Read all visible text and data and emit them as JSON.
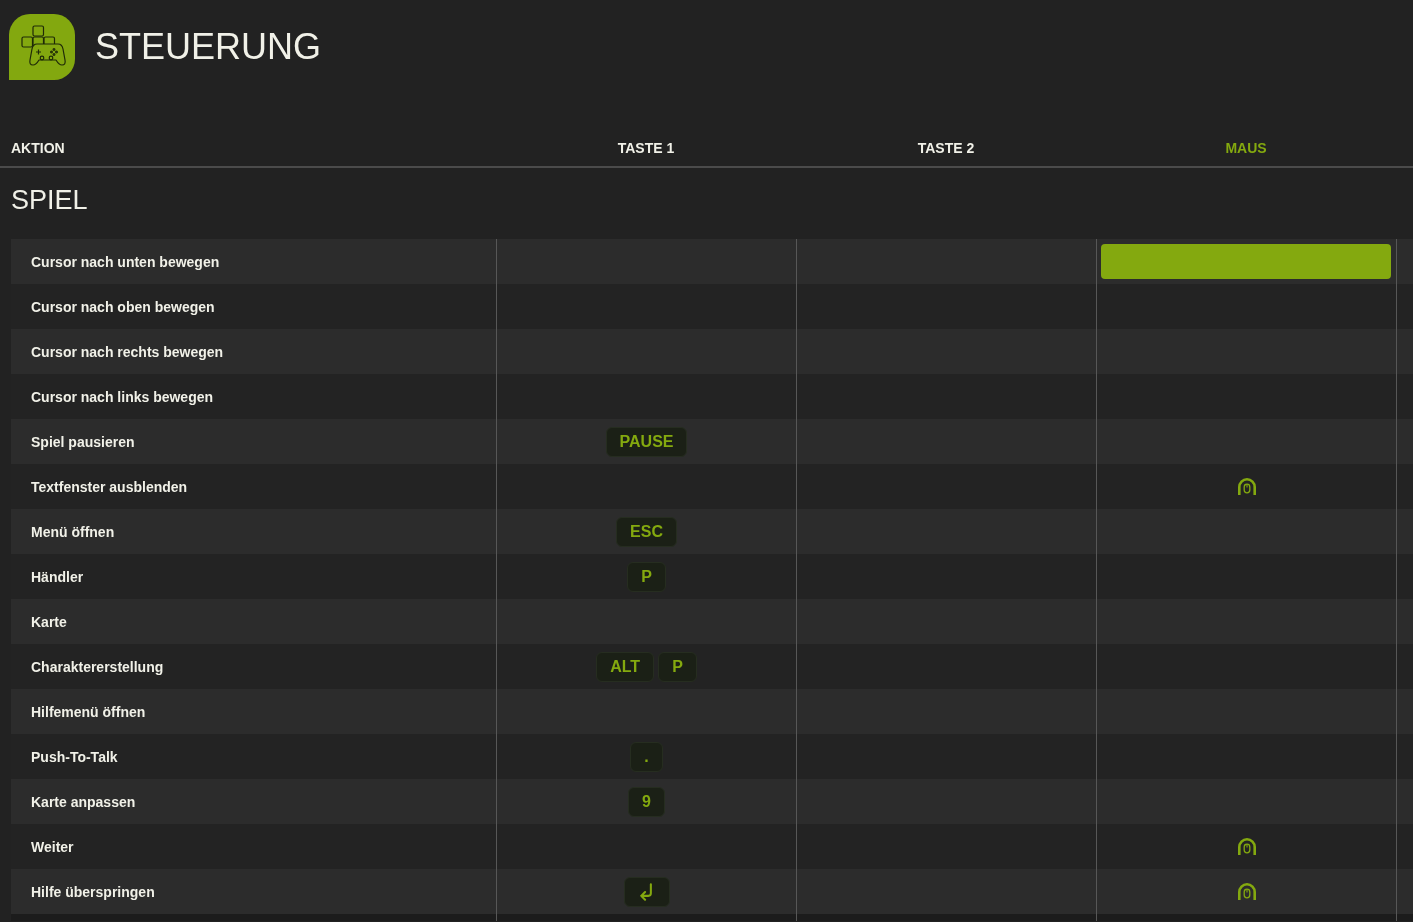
{
  "header": {
    "title": "STEUERUNG"
  },
  "columns": [
    {
      "label": "AKTION",
      "selected": false
    },
    {
      "label": "TASTE 1",
      "selected": false
    },
    {
      "label": "TASTE 2",
      "selected": false
    },
    {
      "label": "MAUS",
      "selected": true
    }
  ],
  "section": {
    "title": "SPIEL",
    "rows": [
      {
        "action": "Cursor nach unten bewegen",
        "bindings": [
          {
            "selected": false
          },
          {
            "selected": false
          },
          {
            "selected": true
          }
        ]
      },
      {
        "action": "Cursor nach oben bewegen",
        "bindings": [
          {
            "selected": false
          },
          {
            "selected": false
          },
          {
            "selected": false
          }
        ]
      },
      {
        "action": "Cursor nach rechts bewegen",
        "bindings": [
          {
            "selected": false
          },
          {
            "selected": false
          },
          {
            "selected": false
          }
        ]
      },
      {
        "action": "Cursor nach links bewegen",
        "bindings": [
          {
            "selected": false
          },
          {
            "selected": false
          },
          {
            "selected": false
          }
        ]
      },
      {
        "action": "Spiel pausieren",
        "bindings": [
          {
            "selected": false,
            "keys": [
              {
                "kind": "key",
                "label": "PAUSE"
              }
            ]
          },
          {
            "selected": false
          },
          {
            "selected": false
          }
        ]
      },
      {
        "action": "Textfenster ausblenden",
        "bindings": [
          {
            "selected": false
          },
          {
            "selected": false
          },
          {
            "selected": false,
            "keys": [
              {
                "kind": "mouse"
              }
            ]
          }
        ]
      },
      {
        "action": "Menü öffnen",
        "bindings": [
          {
            "selected": false,
            "keys": [
              {
                "kind": "key",
                "label": "ESC"
              }
            ]
          },
          {
            "selected": false
          },
          {
            "selected": false
          }
        ]
      },
      {
        "action": "Händler",
        "bindings": [
          {
            "selected": false,
            "keys": [
              {
                "kind": "key",
                "label": "P"
              }
            ]
          },
          {
            "selected": false
          },
          {
            "selected": false
          }
        ]
      },
      {
        "action": "Karte",
        "bindings": [
          {
            "selected": false
          },
          {
            "selected": false
          },
          {
            "selected": false
          }
        ]
      },
      {
        "action": "Charaktererstellung",
        "bindings": [
          {
            "selected": false,
            "keys": [
              {
                "kind": "key",
                "label": "ALT"
              },
              {
                "kind": "key",
                "label": "P"
              }
            ]
          },
          {
            "selected": false
          },
          {
            "selected": false
          }
        ]
      },
      {
        "action": "Hilfemenü öffnen",
        "bindings": [
          {
            "selected": false
          },
          {
            "selected": false
          },
          {
            "selected": false
          }
        ]
      },
      {
        "action": "Push-To-Talk",
        "bindings": [
          {
            "selected": false,
            "keys": [
              {
                "kind": "key",
                "label": "."
              }
            ]
          },
          {
            "selected": false
          },
          {
            "selected": false
          }
        ]
      },
      {
        "action": "Karte anpassen",
        "bindings": [
          {
            "selected": false,
            "keys": [
              {
                "kind": "key",
                "label": "9"
              }
            ]
          },
          {
            "selected": false
          },
          {
            "selected": false
          }
        ]
      },
      {
        "action": "Weiter",
        "bindings": [
          {
            "selected": false
          },
          {
            "selected": false
          },
          {
            "selected": false,
            "keys": [
              {
                "kind": "mouse"
              }
            ]
          }
        ]
      },
      {
        "action": "Hilfe überspringen",
        "bindings": [
          {
            "selected": false,
            "keys": [
              {
                "kind": "enter"
              }
            ]
          },
          {
            "selected": false
          },
          {
            "selected": false,
            "keys": [
              {
                "kind": "mouse"
              }
            ]
          }
        ]
      }
    ]
  }
}
